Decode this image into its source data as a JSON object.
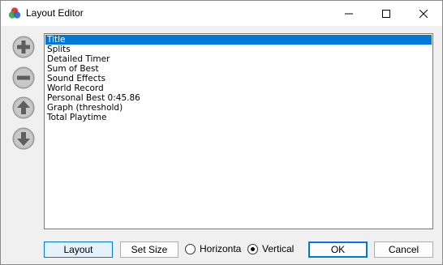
{
  "window": {
    "title": "Layout Editor"
  },
  "side_buttons": {
    "add": "plus-icon",
    "remove": "minus-icon",
    "move_up": "arrow-up-icon",
    "move_down": "arrow-down-icon"
  },
  "components": [
    {
      "label": "Title",
      "selected": true
    },
    {
      "label": "Splits",
      "selected": false
    },
    {
      "label": "Detailed Timer",
      "selected": false
    },
    {
      "label": "Sum of Best",
      "selected": false
    },
    {
      "label": "Sound Effects",
      "selected": false
    },
    {
      "label": "World Record",
      "selected": false
    },
    {
      "label": "Personal Best 0:45.86",
      "selected": false
    },
    {
      "label": "Graph (threshold)",
      "selected": false
    },
    {
      "label": "Total Playtime",
      "selected": false
    }
  ],
  "footer": {
    "layout_label": "Layout",
    "set_size_label": "Set Size",
    "orientation": {
      "horizontal_label": "Horizonta",
      "vertical_label": "Vertical",
      "selected": "Vertical"
    },
    "ok_label": "OK",
    "cancel_label": "Cancel"
  },
  "colors": {
    "selection": "#0078d7",
    "accent_border": "#0078d7"
  }
}
